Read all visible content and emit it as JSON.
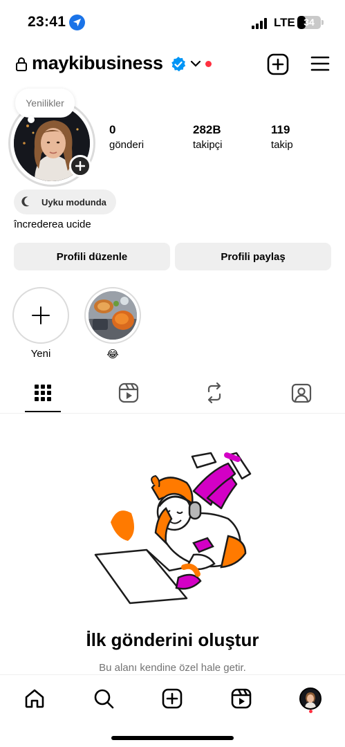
{
  "status_bar": {
    "time": "23:41",
    "network": "LTE",
    "battery": "34",
    "battery_level": 0.34
  },
  "header": {
    "username": "maykibusiness",
    "icons": {
      "lock": "lock-icon",
      "verified": "verified-badge-icon",
      "switch": "chevron-down-icon",
      "create": "create-plus-icon",
      "menu": "hamburger-menu-icon"
    }
  },
  "profile": {
    "note": "Yenilikler",
    "stats": [
      {
        "value": "0",
        "label": "gönderi"
      },
      {
        "value": "282B",
        "label": "takipçi"
      },
      {
        "value": "119",
        "label": "takip"
      }
    ],
    "status_chip": "Uyku modunda",
    "bio": "încrederea ucide",
    "buttons": {
      "edit": "Profili düzenle",
      "share": "Profili paylaş"
    }
  },
  "highlights": [
    {
      "label": "Yeni"
    },
    {
      "label": "😂"
    }
  ],
  "tabs": [
    {
      "icon": "grid-icon",
      "active": true
    },
    {
      "icon": "reels-icon",
      "active": false
    },
    {
      "icon": "reposts-icon",
      "active": false
    },
    {
      "icon": "tagged-icon",
      "active": false
    }
  ],
  "empty_state": {
    "title": "İlk gönderini oluştur",
    "subtitle": "Bu alanı kendine özel hale getir."
  },
  "bottom_nav": [
    "home-icon",
    "search-icon",
    "create-icon",
    "reels-icon",
    "profile-avatar"
  ],
  "colors": {
    "accent_red": "#ff3040",
    "verified_blue": "#0095f6",
    "illustration_orange": "#ff7a00",
    "illustration_magenta": "#d300c5"
  }
}
